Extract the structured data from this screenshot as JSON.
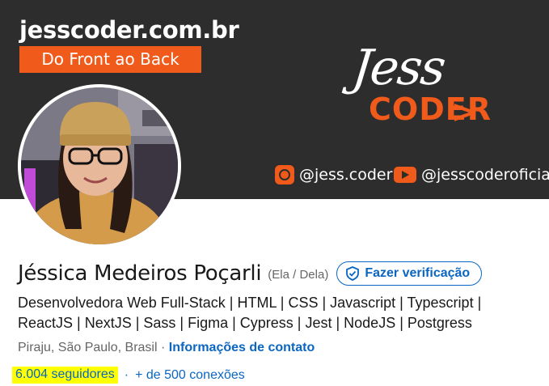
{
  "banner": {
    "site_url": "jesscoder.com.br",
    "tagline": "Do Front ao Back",
    "logo_top": "Jess",
    "logo_bottom": "CODER",
    "logo_chevron": ">",
    "instagram": "@jess.coder",
    "youtube": "@jesscoderoficial",
    "accent_color": "#f05a1a",
    "background_color": "#2d2d2d"
  },
  "profile": {
    "name": "Jéssica Medeiros Poçarli",
    "pronouns": "(Ela / Dela)",
    "verify_label": "Fazer verificação",
    "headline": "Desenvolvedora Web Full-Stack | HTML | CSS | Javascript | Typescript | ReactJS | NextJS | Sass | Figma | Cypress | Jest | NodeJS | Postgress",
    "location": "Piraju, São Paulo, Brasil",
    "separator": "·",
    "contact_info": "Informações de contato",
    "followers": "6.004 seguidores",
    "connections_separator": "·",
    "connections": "+ de 500 conexões",
    "link_color": "#0a66c2"
  }
}
